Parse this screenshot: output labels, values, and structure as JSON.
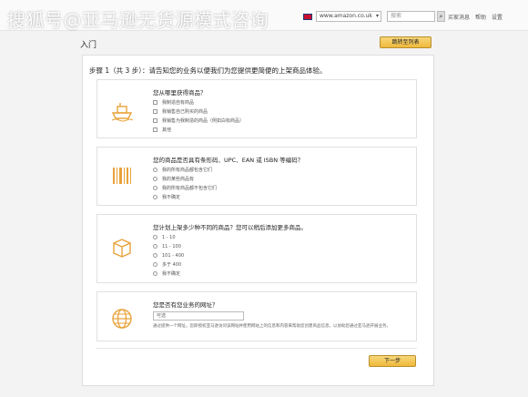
{
  "watermark": "搜狐号@亚马逊无货源模式咨询",
  "header": {
    "region_value": "www.amazon.co.uk",
    "search_placeholder": "搜索",
    "links": [
      "买家消息",
      "帮助",
      "设置"
    ]
  },
  "page": {
    "title": "入门",
    "skip_label": "跳转至列表",
    "step_text": "步骤 1（共 3 步）：请告知您的业务以便我们为您提供更简便的上架商品体验。",
    "next_label": "下一步"
  },
  "questions": [
    {
      "title": "您从哪里获得商品？",
      "icon": "ship-icon",
      "type": "checkbox",
      "options": [
        "我制造自有商品",
        "我销售自己购买的商品",
        "我销售为我制造的商品（例如白标商品）",
        "其他"
      ]
    },
    {
      "title": "您的商品是否具有条形码、UPC、EAN 或 ISBN 等编码？",
      "icon": "barcode-icon",
      "type": "radio",
      "options": [
        "我的所有商品都包含它们",
        "我的某些商品有",
        "我的所有商品都不包含它们",
        "我不确定"
      ]
    },
    {
      "title": "您计划上架多少种不同的商品？您可以稍后添加更多商品。",
      "icon": "box-icon",
      "type": "radio",
      "options": [
        "1 - 10",
        "11 - 100",
        "101 - 400",
        "多于 400",
        "我不确定"
      ]
    },
    {
      "title": "您是否有您业务的网址？",
      "icon": "globe-icon",
      "type": "url",
      "input_placeholder": "可选",
      "help_text": "通过提供一个网址，您即授权亚马逊访问该网站并使用网站上的信息和内容来帮助您创建商品信息，以协助您通过亚马逊开展业务。"
    }
  ],
  "colors": {
    "accent": "#efb93b",
    "icon": "#e8a23a"
  }
}
